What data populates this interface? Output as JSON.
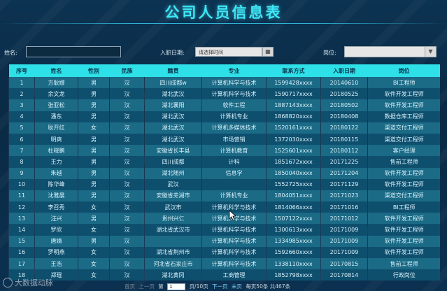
{
  "title": "公司人员信息表",
  "filters": {
    "name_label": "姓名:",
    "name_value": "",
    "date_label": "入职日期:",
    "date_placeholder": "请选择时间",
    "position_label": "岗位:",
    "position_value": ""
  },
  "table": {
    "headers": [
      "序号",
      "姓名",
      "性别",
      "民族",
      "籍贯",
      "专业",
      "联系方式",
      "入职日期",
      "岗位"
    ],
    "rows": [
      [
        "1",
        "方耿娜",
        "男",
        "汉",
        "四川成都w",
        "计算机科学与技术",
        "1599428xxxx",
        "20140610",
        "BI工程师"
      ],
      [
        "2",
        "余文龙",
        "男",
        "汉",
        "湖北武汉",
        "计算机科学与技术",
        "1590717xxxx",
        "20180525",
        "软件开发工程师"
      ],
      [
        "3",
        "张亚松",
        "男",
        "汉",
        "湖北襄阳",
        "软件工程",
        "1887143xxxx",
        "20180502",
        "软件开发工程师"
      ],
      [
        "4",
        "潘东",
        "男",
        "汉",
        "湖北武汉",
        "计算机专业",
        "1868820xxxx",
        "20180408",
        "数据仓库工程师"
      ],
      [
        "5",
        "耿开红",
        "女",
        "汉",
        "湖北武汉",
        "计算机多媒体技术",
        "1520161xxxx",
        "20180122",
        "渠道交付工程师"
      ],
      [
        "6",
        "明爽",
        "男",
        "汉",
        "湖北武汉",
        "市场营销",
        "1372030xxxx",
        "20180115",
        "渠道交付工程师"
      ],
      [
        "7",
        "杜晓鹏",
        "男",
        "汉",
        "安徽省长丰县",
        "计算机教育",
        "1525601xxxx",
        "20180112",
        "客户经理"
      ],
      [
        "8",
        "王力",
        "男",
        "汉",
        "四川成都",
        "计科",
        "1851672xxxx",
        "20171225",
        "售前工程师"
      ],
      [
        "9",
        "朱越",
        "男",
        "汉",
        "湖北随州",
        "信息学",
        "1850040xxxx",
        "20171204",
        "软件开发工程师"
      ],
      [
        "10",
        "陈华峰",
        "男",
        "汉",
        "武汉",
        "",
        "1552725xxxx",
        "20171129",
        "软件开发工程师"
      ],
      [
        "11",
        "沈雅晨",
        "男",
        "汉",
        "安徽省芜湖市",
        "计算机专业",
        "1804051xxxx",
        "20171023",
        "渠道交付工程师"
      ],
      [
        "12",
        "李召秀",
        "女",
        "汉",
        "武汉市",
        "计算机科学与技术",
        "1814066xxxx",
        "20171016",
        "BI工程师"
      ],
      [
        "13",
        "汪兴",
        "男",
        "汉",
        "贵州兴仁",
        "计算机科学与技术",
        "1507122xxxx",
        "20171012",
        "软件开发工程师"
      ],
      [
        "14",
        "罗欣",
        "女",
        "汉",
        "湖北省武汉市",
        "计算机科学与技术",
        "1300613xxxx",
        "20171009",
        "软件开发工程师"
      ],
      [
        "15",
        "唐婧",
        "男",
        "汉",
        "",
        "计算机科学与技术",
        "1334985xxxx",
        "20171009",
        "软件开发工程师"
      ],
      [
        "16",
        "罗明燕",
        "女",
        "汉",
        "湖北省荆州市",
        "计算机科学与技术",
        "1592660xxxx",
        "20171009",
        "软件开发工程师"
      ],
      [
        "17",
        "王浩",
        "女",
        "汉",
        "河北省石家庄市",
        "计算机科学与技术",
        "1338110xxxx",
        "20170815",
        "售前工程师"
      ],
      [
        "18",
        "郑琨",
        "女",
        "汉",
        "湖北黄冈",
        "工商管理",
        "1852798xxxx",
        "20170814",
        "行政岗位"
      ]
    ]
  },
  "pager": {
    "first": "首页",
    "prev": "上一页",
    "page_prefix": "第",
    "page_value": "1",
    "page_suffix": "页/10页",
    "next": "下一页",
    "last": "末页",
    "summary": "每页50条 共467条"
  },
  "watermark": "大数据动脉",
  "colors": {
    "title": "#3fe7f6",
    "header_bg": "#2ee0e8",
    "row_odd": "#1b6a86",
    "row_even": "#0f4f6e",
    "page_bg": "#0b2a44"
  }
}
